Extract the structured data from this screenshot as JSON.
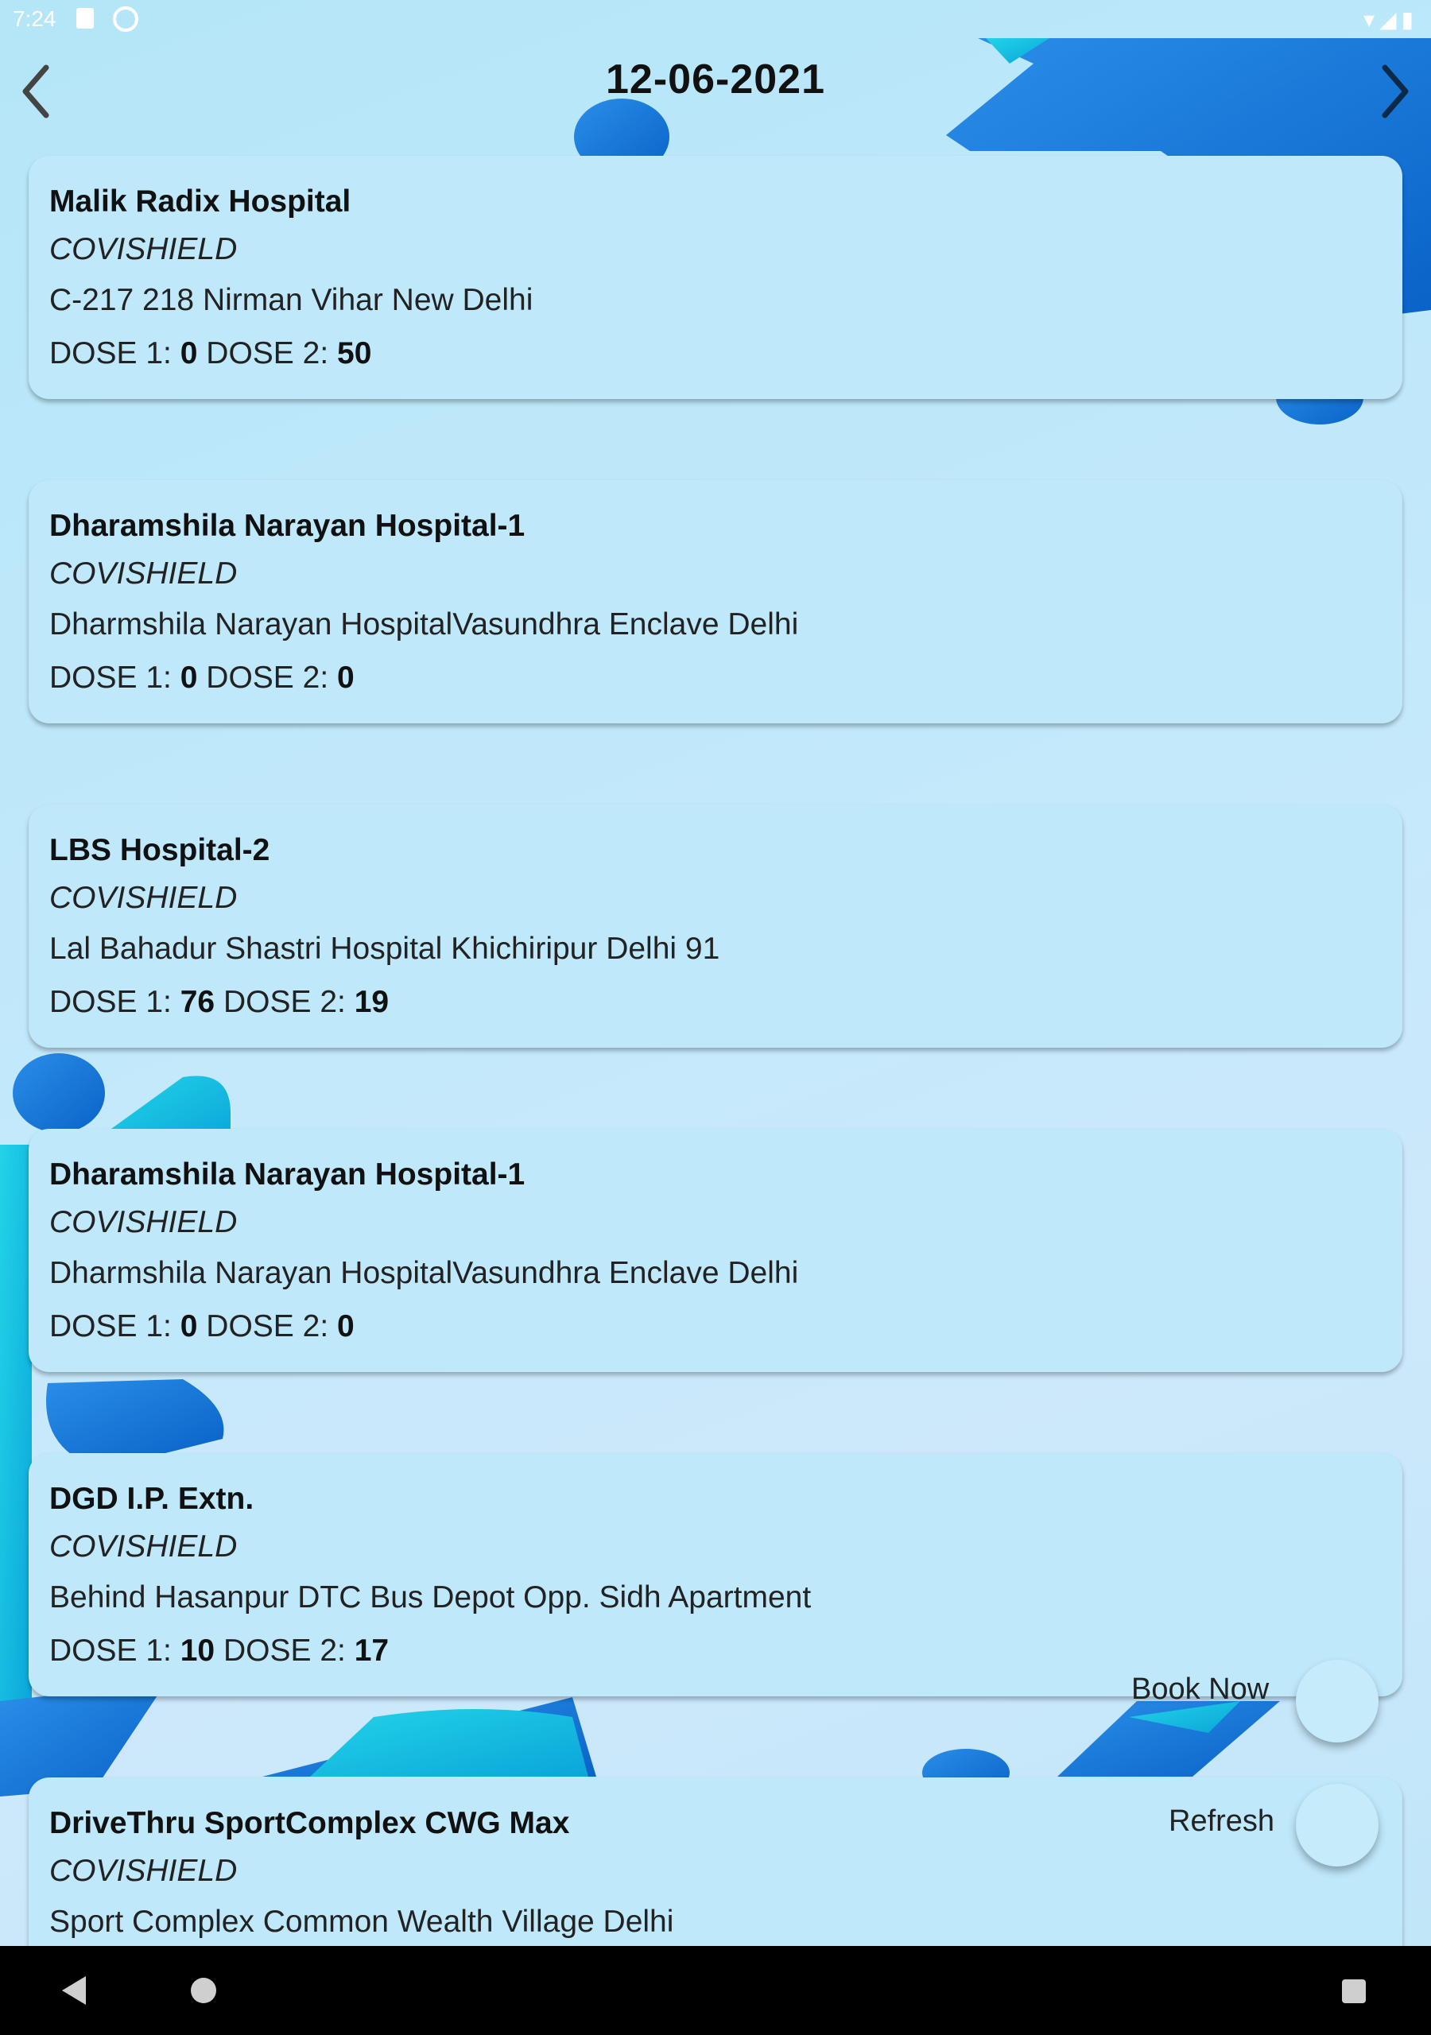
{
  "status_bar": {
    "time": "7:24"
  },
  "header": {
    "date": "12-06-2021",
    "prev_icon": "chevron-left-icon",
    "next_icon": "chevron-right-icon"
  },
  "centers": [
    {
      "name": "Malik Radix Hospital",
      "vaccine": "COVISHIELD",
      "address": "C-217 218 Nirman Vihar New Delhi",
      "dose1_label": "DOSE 1:",
      "dose1": "0",
      "dose2_label": "DOSE 2:",
      "dose2": "50"
    },
    {
      "name": "Dharamshila Narayan Hospital-1",
      "vaccine": "COVISHIELD",
      "address": "Dharmshila Narayan HospitalVasundhra Enclave Delhi",
      "dose1_label": "DOSE 1:",
      "dose1": "0",
      "dose2_label": "DOSE 2:",
      "dose2": "0"
    },
    {
      "name": "LBS Hospital-2",
      "vaccine": "COVISHIELD",
      "address": "Lal Bahadur Shastri Hospital Khichiripur Delhi 91",
      "dose1_label": "DOSE 1:",
      "dose1": "76",
      "dose2_label": "DOSE 2:",
      "dose2": "19"
    },
    {
      "name": "Dharamshila Narayan Hospital-1",
      "vaccine": "COVISHIELD",
      "address": "Dharmshila Narayan HospitalVasundhra Enclave Delhi",
      "dose1_label": "DOSE 1:",
      "dose1": "0",
      "dose2_label": "DOSE 2:",
      "dose2": "0"
    },
    {
      "name": "DGD I.P. Extn.",
      "vaccine": "COVISHIELD",
      "address": "Behind Hasanpur DTC Bus Depot Opp. Sidh Apartment",
      "dose1_label": "DOSE 1:",
      "dose1": "10",
      "dose2_label": "DOSE 2:",
      "dose2": "17"
    },
    {
      "name": "DriveThru SportComplex CWG Max",
      "vaccine": "COVISHIELD",
      "address": "Sport Complex Common Wealth Village Delhi",
      "dose1_label": "",
      "dose1": "",
      "dose2_label": "",
      "dose2": ""
    }
  ],
  "actions": {
    "book_now": "Book Now",
    "refresh": "Refresh"
  },
  "colors": {
    "card_bg": "#bfe8fb",
    "accent_blue": "#0a7fd8",
    "accent_cyan": "#12c2df",
    "background": "#c3e9fb"
  }
}
